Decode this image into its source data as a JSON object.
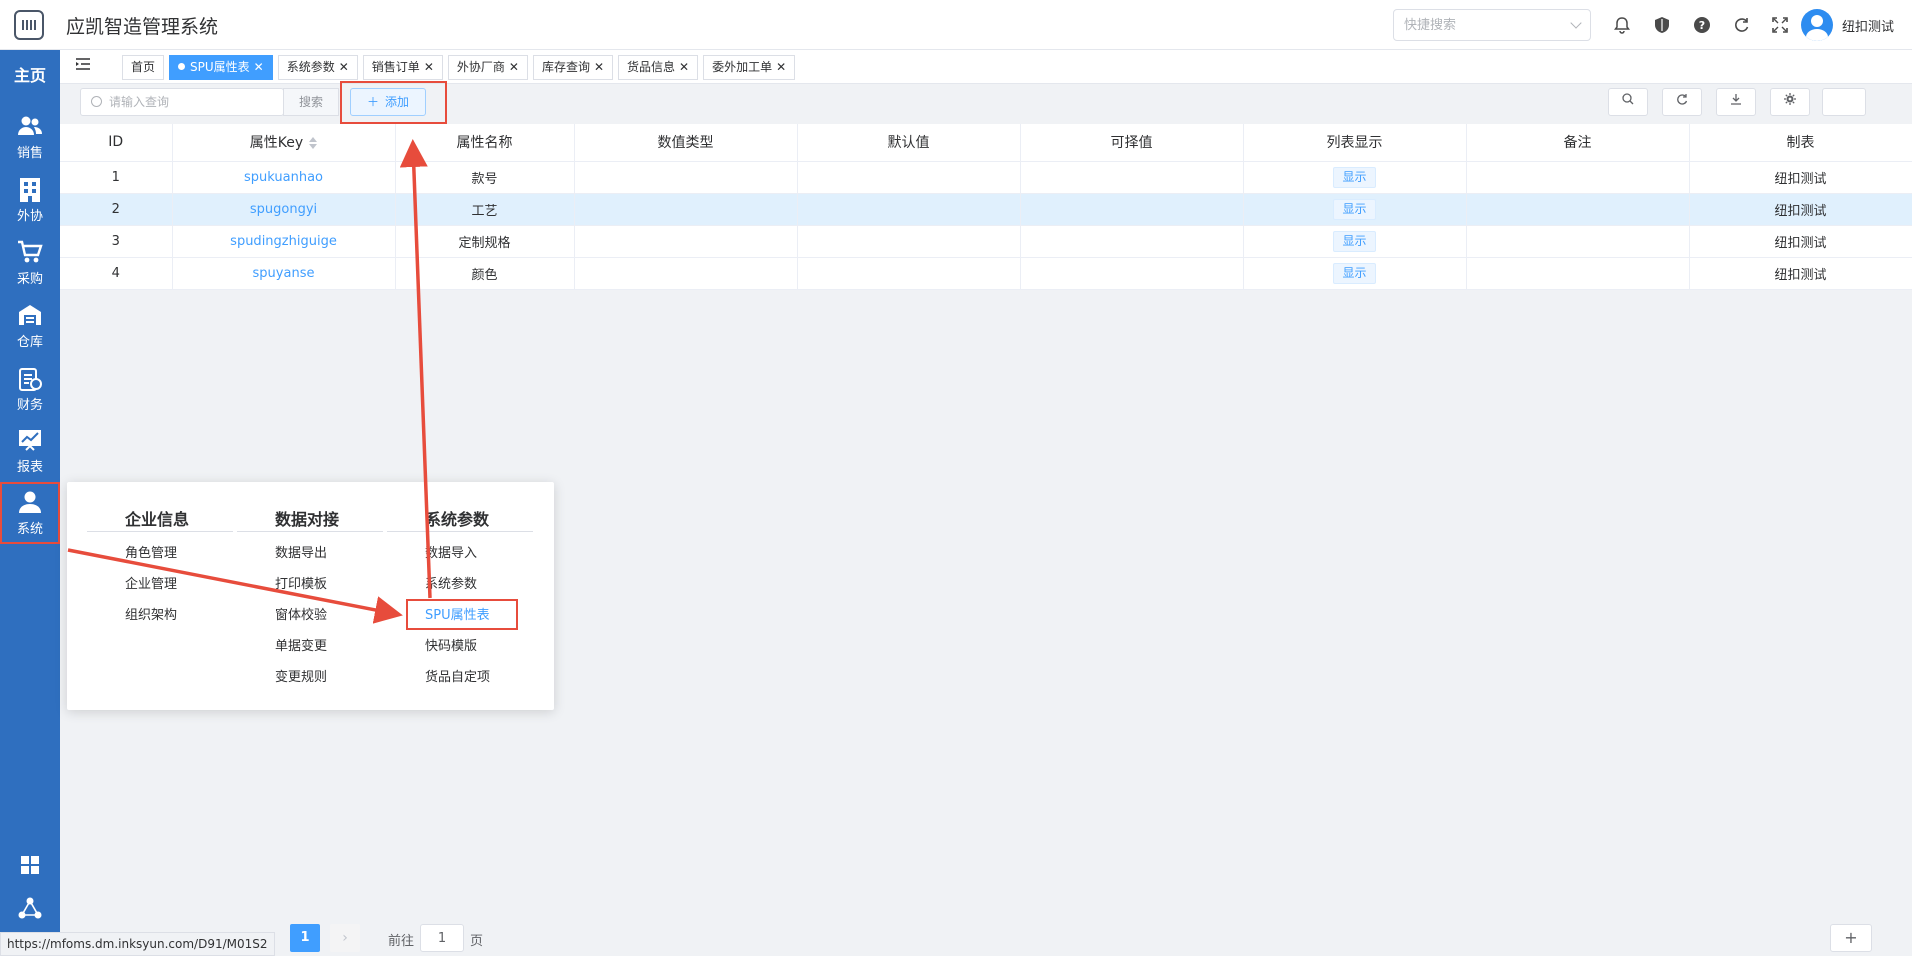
{
  "header": {
    "app_title": "应凯智造管理系统",
    "quick_search_placeholder": "快捷搜索",
    "username": "纽扣测试"
  },
  "sidebar": {
    "home_label": "主页",
    "items": [
      {
        "label": "销售",
        "icon": "users-icon"
      },
      {
        "label": "外协",
        "icon": "building-icon"
      },
      {
        "label": "采购",
        "icon": "cart-icon"
      },
      {
        "label": "仓库",
        "icon": "warehouse-icon"
      },
      {
        "label": "财务",
        "icon": "finance-icon"
      },
      {
        "label": "报表",
        "icon": "chart-icon"
      },
      {
        "label": "系统",
        "icon": "user-icon",
        "active": true
      }
    ]
  },
  "tabs": [
    {
      "label": "首页",
      "closable": false
    },
    {
      "label": "SPU属性表",
      "closable": true,
      "active": true
    },
    {
      "label": "系统参数",
      "closable": true
    },
    {
      "label": "销售订单",
      "closable": true
    },
    {
      "label": "外协厂商",
      "closable": true
    },
    {
      "label": "库存查询",
      "closable": true
    },
    {
      "label": "货品信息",
      "closable": true
    },
    {
      "label": "委外加工单",
      "closable": true
    }
  ],
  "toolbar": {
    "search_placeholder": "请输入查询",
    "search_button": "搜索",
    "add_button": "添加"
  },
  "table": {
    "columns": [
      "ID",
      "属性Key",
      "属性名称",
      "数值类型",
      "默认值",
      "可择值",
      "列表显示",
      "备注",
      "制表"
    ],
    "rows": [
      {
        "id": "1",
        "key": "spukuanhao",
        "name": "款号",
        "type": "",
        "default": "",
        "options": "",
        "show": "显示",
        "note": "",
        "maker": "纽扣测试"
      },
      {
        "id": "2",
        "key": "spugongyi",
        "name": "工艺",
        "type": "",
        "default": "",
        "options": "",
        "show": "显示",
        "note": "",
        "maker": "纽扣测试"
      },
      {
        "id": "3",
        "key": "spudingzhiguige",
        "name": "定制规格",
        "type": "",
        "default": "",
        "options": "",
        "show": "显示",
        "note": "",
        "maker": "纽扣测试"
      },
      {
        "id": "4",
        "key": "spuyanse",
        "name": "颜色",
        "type": "",
        "default": "",
        "options": "",
        "show": "显示",
        "note": "",
        "maker": "纽扣测试"
      }
    ]
  },
  "mega_menu": {
    "columns": [
      {
        "title": "企业信息",
        "items": [
          "角色管理",
          "企业管理",
          "组织架构"
        ]
      },
      {
        "title": "数据对接",
        "items": [
          "数据导出",
          "打印模板",
          "窗体校验",
          "单据变更",
          "变更规则"
        ]
      },
      {
        "title": "系统参数",
        "items": [
          "数据导入",
          "系统参数",
          "SPU属性表",
          "快码模版",
          "货品自定项"
        ]
      }
    ],
    "selected": "SPU属性表"
  },
  "footer": {
    "status_url": "https://mfoms.dm.inksyun.com/D91/M01S2",
    "current_page": "1",
    "goto_label": "前往",
    "goto_value": "1",
    "page_suffix": "页",
    "add_label": "+"
  },
  "colors": {
    "sidebar": "#2f6fbf",
    "accent": "#409eff",
    "highlight": "#e74c3c"
  }
}
